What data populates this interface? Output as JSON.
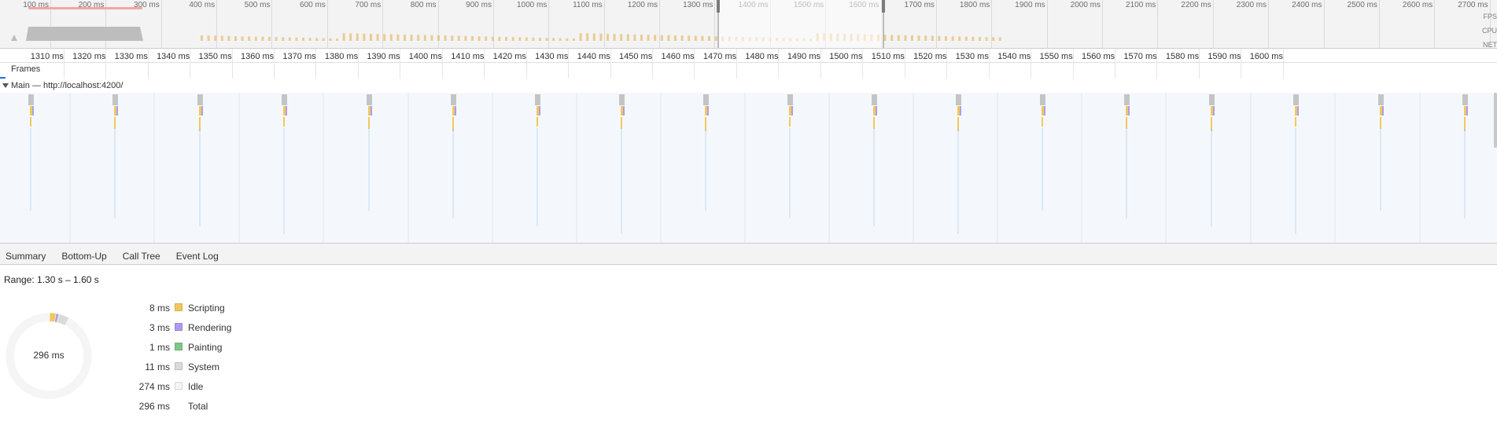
{
  "overview": {
    "ticks": [
      "100 ms",
      "200 ms",
      "300 ms",
      "400 ms",
      "500 ms",
      "600 ms",
      "700 ms",
      "800 ms",
      "900 ms",
      "1000 ms",
      "1100 ms",
      "1200 ms",
      "1300 ms",
      "1400 ms",
      "1500 ms",
      "1600 ms",
      "1700 ms",
      "1800 ms",
      "1900 ms",
      "2000 ms",
      "2100 ms",
      "2200 ms",
      "2300 ms",
      "2400 ms",
      "2500 ms",
      "2600 ms",
      "2700 ms"
    ],
    "selection_start_ms": 1300,
    "selection_end_ms": 1600,
    "lane_labels": [
      "FPS",
      "CPU",
      "NET"
    ],
    "colors": {
      "fps": "#f6a5a5",
      "cpu": "#e6c27c",
      "gray": "#bdbdbd"
    }
  },
  "ruler": {
    "ticks": [
      "1310 ms",
      "1320 ms",
      "1330 ms",
      "1340 ms",
      "1350 ms",
      "1360 ms",
      "1370 ms",
      "1380 ms",
      "1390 ms",
      "1400 ms",
      "1410 ms",
      "1420 ms",
      "1430 ms",
      "1440 ms",
      "1450 ms",
      "1460 ms",
      "1470 ms",
      "1480 ms",
      "1490 ms",
      "1500 ms",
      "1510 ms",
      "1520 ms",
      "1530 ms",
      "1540 ms",
      "1550 ms",
      "1560 ms",
      "1570 ms",
      "1580 ms",
      "1590 ms",
      "1600 ms"
    ]
  },
  "tracks": {
    "frames_label": "Frames",
    "main_label": "Main — http://localhost:4200/"
  },
  "tabs": [
    {
      "label": "Summary",
      "active": true
    },
    {
      "label": "Bottom-Up",
      "active": false
    },
    {
      "label": "Call Tree",
      "active": false
    },
    {
      "label": "Event Log",
      "active": false
    }
  ],
  "summary": {
    "range": "Range: 1.30 s – 1.60 s",
    "total_label": "296 ms",
    "rows": [
      {
        "value": "8 ms",
        "label": "Scripting",
        "color": "#f2c85b",
        "ms": 8
      },
      {
        "value": "3 ms",
        "label": "Rendering",
        "color": "#af9af2",
        "ms": 3
      },
      {
        "value": "1 ms",
        "label": "Painting",
        "color": "#81c784",
        "ms": 1
      },
      {
        "value": "11 ms",
        "label": "System",
        "color": "#dadada",
        "ms": 11
      },
      {
        "value": "274 ms",
        "label": "Idle",
        "color": "#f5f5f5",
        "ms": 274
      },
      {
        "value": "296 ms",
        "label": "Total",
        "color": "",
        "ms": 296
      }
    ]
  },
  "flame": {
    "colors": {
      "scripting": "#f2c85b",
      "rendering": "#af9af2",
      "system": "#c4c4c4",
      "line": "#9ec3e8"
    }
  }
}
